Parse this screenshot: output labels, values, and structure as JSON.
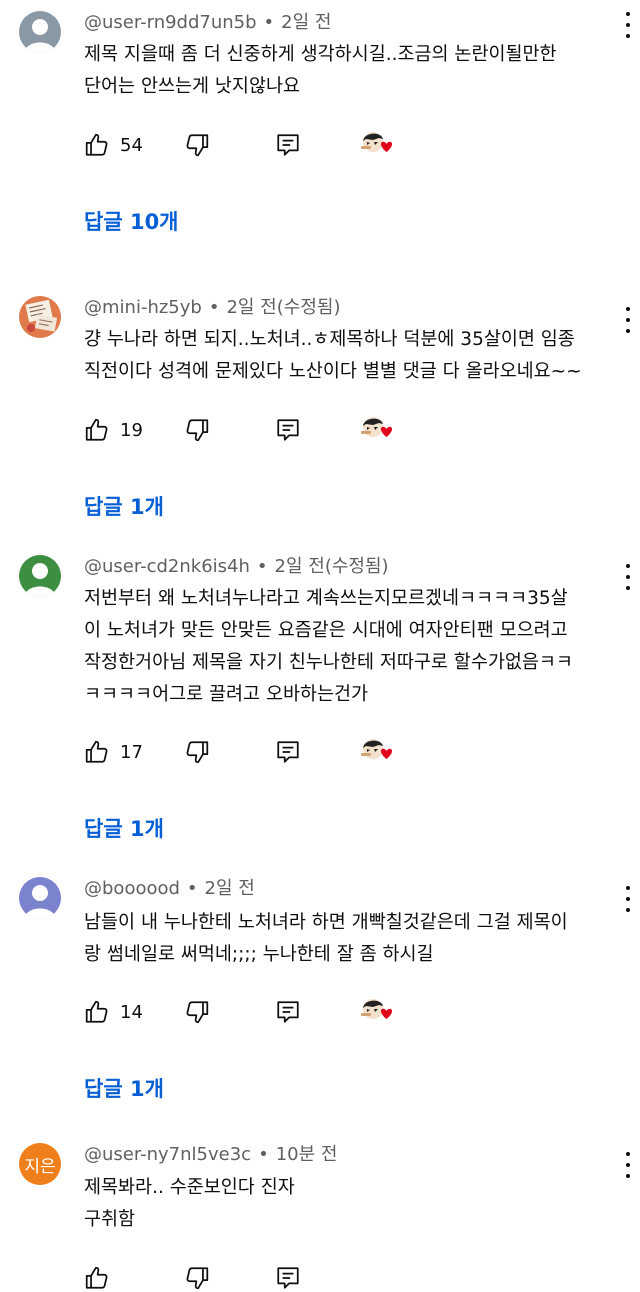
{
  "comments": [
    {
      "author": "@user-rn9dd7un5b",
      "time": "2일 전",
      "edited": "",
      "lines": [
        "제목 지을때 좀 더 신중하게 생각하시길..조금의 논란이될만한",
        "단어는 안쓰는게 낫지않나요"
      ],
      "likes": "54",
      "replies": "답글 10개",
      "avatar": {
        "type": "default",
        "color": "#8a98a6"
      }
    },
    {
      "author": "@mini-hz5yb",
      "time": "2일 전",
      "edited": "(수정됨)",
      "lines": [
        "걍 누나라 하면 되지..노처녀..ㅎ제목하나 덕분에 35살이면 임종",
        "직전이다 성격에 문제있다 노산이다 별별 댓글 다 올라오네요~~"
      ],
      "likes": "19",
      "replies": "답글 1개",
      "avatar": {
        "type": "image",
        "color": "#e07a4a"
      }
    },
    {
      "author": "@user-cd2nk6is4h",
      "time": "2일 전",
      "edited": "(수정됨)",
      "lines": [
        "저번부터 왜 노처녀누나라고 계속쓰는지모르겠네ㅋㅋㅋㅋ35살",
        "이 노처녀가 맞든 안맞든 요즘같은 시대에 여자안티팬 모으려고",
        "작정한거아님 제목을 자기 친누나한테 저따구로 할수가없음ㅋㅋ",
        "ㅋㅋㅋㅋ어그로 끌려고 오바하는건가"
      ],
      "likes": "17",
      "replies": "답글 1개",
      "avatar": {
        "type": "default",
        "color": "#3e8e41"
      }
    },
    {
      "author": "@boooood",
      "time": "2일 전",
      "edited": "",
      "lines": [
        "남들이 내 누나한테 노처녀라 하면 개빡칠것같은데 그걸 제목이",
        "랑 썸네일로 써먹네;;;; 누나한테 잘 좀 하시길"
      ],
      "likes": "14",
      "replies": "답글 1개",
      "avatar": {
        "type": "default",
        "color": "#7b83cf"
      }
    },
    {
      "author": "@user-ny7nl5ve3c",
      "time": "10분 전",
      "edited": "",
      "lines": [
        "제목봐라.. 수준보인다 진자",
        "구취함"
      ],
      "likes": "",
      "replies": "",
      "avatar": {
        "type": "letter",
        "letter": "지은",
        "color": "#ef7f1a"
      }
    }
  ],
  "icons": {
    "like": "thumbs-up-icon",
    "dislike": "thumbs-down-icon",
    "reply": "reply-comment-icon",
    "creator_heart": "creator-heart-icon",
    "more": "more-vertical-icon"
  },
  "colors": {
    "link": "#065fd4",
    "meta": "#606060",
    "heart": "#e0001b"
  }
}
